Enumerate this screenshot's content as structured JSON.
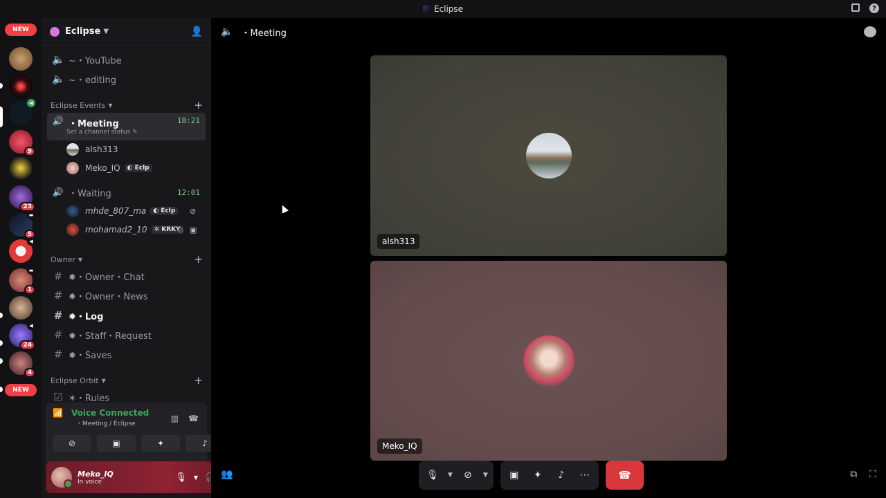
{
  "window": {
    "title": "Eclipse"
  },
  "rail": {
    "new_top": "NEW",
    "new_bottom": "NEW",
    "badges": [
      "9",
      "23",
      "5",
      "1",
      "24",
      "4"
    ]
  },
  "guild": {
    "name": "Eclipse"
  },
  "channels": {
    "youtube": "~・YouTube",
    "editing": "~・editing",
    "cat_events": "Eclipse Events",
    "meeting": "・Meeting",
    "meeting_time": "18:21",
    "meeting_status": "Set a channel status",
    "meeting_users": [
      {
        "name": "alsh313",
        "tag": ""
      },
      {
        "name": "Meko_IQ",
        "tag": "Eclp"
      }
    ],
    "waiting": "・Waiting",
    "waiting_time": "12:01",
    "waiting_users": [
      {
        "name": "mhde_807_ma",
        "tag": "Eclp"
      },
      {
        "name": "mohamad2_10",
        "tag": "KRKY"
      }
    ],
    "cat_owner": "Owner",
    "owner_chat": "✹・Owner・Chat",
    "owner_news": "✹・Owner・News",
    "log": "✹・Log",
    "staff_request": "✹・Staff・Request",
    "saves": "✹・Saves",
    "cat_orbit": "Eclipse Orbit",
    "rules": "✶・Rules"
  },
  "voice_panel": {
    "title": "Voice Connected",
    "subtitle": "・Meeting / Eclipse"
  },
  "user": {
    "name": "Meko_IQ",
    "status": "In voice"
  },
  "main": {
    "channel": "・Meeting",
    "tiles": [
      {
        "name": "alsh313"
      },
      {
        "name": "Meko_IQ"
      }
    ]
  },
  "icons": {
    "speaker": "speaker-icon",
    "add_friend": "add-friend-icon",
    "chat": "chat-icon",
    "mic": "mic-icon",
    "camera_off": "camera-off-icon",
    "screen_share": "screen-share-icon",
    "activities": "activities-icon",
    "soundboard": "soundboard-icon",
    "more": "more-icon",
    "end_call": "end-call-icon",
    "popout": "popout-icon",
    "fullscreen": "fullscreen-icon"
  },
  "colors": {
    "accent_green": "#3ba55c",
    "danger": "#da373c",
    "mention": "#f23f43"
  }
}
